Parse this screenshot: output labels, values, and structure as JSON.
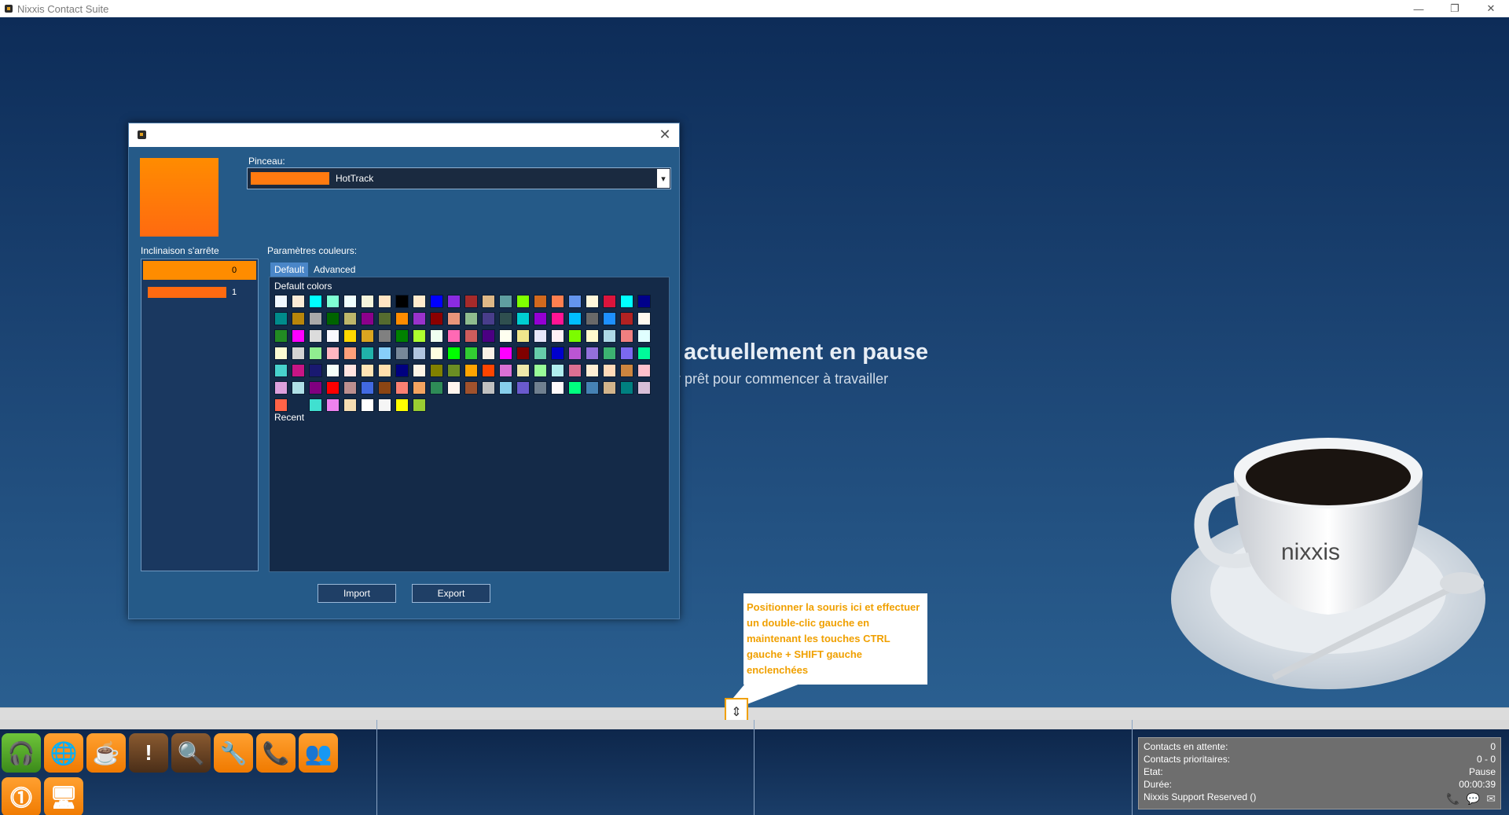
{
  "window": {
    "title": "Nixxis Contact Suite",
    "controls": [
      "—",
      "❐",
      "✕"
    ]
  },
  "pause": {
    "title": "actuellement en pause",
    "subtitle": "r prêt pour commencer à travailler"
  },
  "dialog": {
    "close": "✕",
    "pinceau_label": "Pinceau:",
    "brush_value": "HotTrack",
    "brush_color": "#ff7a10",
    "stops_label": "Inclinaison s'arrête",
    "stops": [
      {
        "index": "0",
        "color": "#ff8c00"
      },
      {
        "index": "1",
        "color": "#ff6a10"
      }
    ],
    "colors_label": "Paramètres couleurs:",
    "tabs": [
      "Default",
      "Advanced"
    ],
    "default_colors_label": "Default colors",
    "recent_label": "Recent",
    "import_label": "Import",
    "export_label": "Export",
    "palette": [
      "#f0f8ff",
      "#faebd7",
      "#00ffff",
      "#7fffd4",
      "#f0ffff",
      "#f5f5dc",
      "#ffe4c4",
      "#000000",
      "#ffebcd",
      "#0000ff",
      "#8a2be2",
      "#a52a2a",
      "#deb887",
      "#5f9ea0",
      "#7fff00",
      "#d2691e",
      "#ff7f50",
      "#6495ed",
      "#fff8dc",
      "#dc143c",
      "#00ffff",
      "#00008b",
      "#008b8b",
      "#b8860b",
      "#a9a9a9",
      "#006400",
      "#bdb76b",
      "#8b008b",
      "#556b2f",
      "#ff8c00",
      "#9932cc",
      "#8b0000",
      "#e9967a",
      "#8fbc8f",
      "#483d8b",
      "#2f4f4f",
      "#00ced1",
      "#9400d3",
      "#ff1493",
      "#00bfff",
      "#696969",
      "#1e90ff",
      "#b22222",
      "#fffaf0",
      "#228b22",
      "#ff00ff",
      "#dcdcdc",
      "#f8f8ff",
      "#ffd700",
      "#daa520",
      "#808080",
      "#008000",
      "#adff2f",
      "#f0fff0",
      "#ff69b4",
      "#cd5c5c",
      "#4b0082",
      "#fffff0",
      "#f0e68c",
      "#e6e6fa",
      "#fff0f5",
      "#7cfc00",
      "#fffacd",
      "#add8e6",
      "#f08080",
      "#e0ffff",
      "#fafad2",
      "#d3d3d3",
      "#90ee90",
      "#ffb6c1",
      "#ffa07a",
      "#20b2aa",
      "#87cefa",
      "#778899",
      "#b0c4de",
      "#ffffe0",
      "#00ff00",
      "#32cd32",
      "#faf0e6",
      "#ff00ff",
      "#800000",
      "#66cdaa",
      "#0000cd",
      "#ba55d3",
      "#9370db",
      "#3cb371",
      "#7b68ee",
      "#00fa9a",
      "#48d1cc",
      "#c71585",
      "#191970",
      "#f5fffa",
      "#ffe4e1",
      "#ffe4b5",
      "#ffdead",
      "#000080",
      "#fdf5e6",
      "#808000",
      "#6b8e23",
      "#ffa500",
      "#ff4500",
      "#da70d6",
      "#eee8aa",
      "#98fb98",
      "#afeeee",
      "#db7093",
      "#ffefd5",
      "#ffdab9",
      "#cd853f",
      "#ffc0cb",
      "#dda0dd",
      "#b0e0e6",
      "#800080",
      "#ff0000",
      "#bc8f8f",
      "#4169e1",
      "#8b4513",
      "#fa8072",
      "#f4a460",
      "#2e8b57",
      "#fff5ee",
      "#a0522d",
      "#c0c0c0",
      "#87ceeb",
      "#6a5acd",
      "#708090",
      "#fffafa",
      "#00ff7f",
      "#4682b4",
      "#d2b48c",
      "#008080",
      "#d8bfd8",
      "#ff6347",
      "",
      "#40e0d0",
      "#ee82ee",
      "#f5deb3",
      "#ffffff",
      "#f5f5f5",
      "#ffff00",
      "#9acd32"
    ]
  },
  "callout": {
    "text": "Positionner la souris ici et effectuer un double-clic gauche en maintenant les touches CTRL gauche + SHIFT gauche enclenchées"
  },
  "splitter": {
    "handle_glyph": "⇕"
  },
  "dock": [
    {
      "name": "headset-icon",
      "glyph": "🎧",
      "style": "green"
    },
    {
      "name": "globe-icon",
      "glyph": "🌐",
      "style": "orange"
    },
    {
      "name": "coffee-icon",
      "glyph": "☕",
      "style": "orange"
    },
    {
      "name": "alert-icon",
      "glyph": "!",
      "style": "brown"
    },
    {
      "name": "search-icon",
      "glyph": "🔍",
      "style": "brown"
    },
    {
      "name": "wrench-icon",
      "glyph": "🔧",
      "style": "orange"
    },
    {
      "name": "phone-add-icon",
      "glyph": "📞",
      "style": "orange"
    },
    {
      "name": "users-icon",
      "glyph": "👥",
      "style": "orange"
    },
    {
      "name": "warning-circle-icon",
      "glyph": "⓵",
      "style": "orange"
    },
    {
      "name": "monitor-icon",
      "glyph": "🖥",
      "style": "orange"
    }
  ],
  "status": {
    "rows": [
      {
        "label": "Contacts en attente:",
        "value": "0"
      },
      {
        "label": "Contacts prioritaires:",
        "value": "0 - 0"
      },
      {
        "label": "Etat:",
        "value": "Pause"
      },
      {
        "label": "Durée:",
        "value": "00:00:39"
      },
      {
        "label": "Nixxis Support Reserved ()",
        "value": ""
      }
    ],
    "icons": [
      "📞",
      "💬",
      "✉"
    ]
  }
}
